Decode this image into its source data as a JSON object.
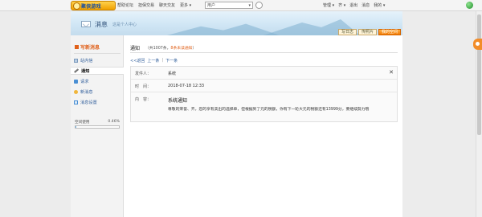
{
  "topbar": {
    "logo_text": "聚侠游戏",
    "nav": [
      "帮助论坛",
      "担保交易",
      "聊天交友",
      "更多 ▾"
    ],
    "user_select": "用户",
    "right_links": [
      "管理 ▾",
      "齐 ▾",
      "退出",
      "消息",
      "我的 ▾"
    ]
  },
  "banner": {
    "title": "消息",
    "subtitle": "这是个人中心",
    "buttons": [
      "写日志",
      "传照片",
      "我的空间"
    ]
  },
  "sidebar": {
    "compose": "写新消息",
    "items": [
      {
        "label": "站内信",
        "active": false,
        "icon": "inbox-icon"
      },
      {
        "label": "通知",
        "active": true,
        "icon": "pencil-icon"
      },
      {
        "label": "请求",
        "active": false,
        "icon": "request-icon"
      },
      {
        "label": "新消息",
        "active": false,
        "icon": "news-icon"
      },
      {
        "label": "消息设置",
        "active": false,
        "icon": "settings-icon"
      }
    ],
    "space_label": "空间使用",
    "space_pct": "0.46%",
    "space_value": 0.0046
  },
  "main": {
    "title": "通知",
    "count_prefix": "（共1007条，",
    "unread": "8条未读通知",
    "count_suffix": "）",
    "pager": {
      "back": "<<返回",
      "prev": "上一条",
      "sep": "|",
      "next": "下一条"
    },
    "message": {
      "sender_label": "发件人：",
      "sender": "系统",
      "time_label": "时　间：",
      "time": "2018-07-18 12:33",
      "content_label": "内　容：",
      "content_title": "系统通知",
      "content_body": "尊敬的荣誉、齐，您的享有卖出的选择单，但根据到了元的税额，你有下一轮大元的税额还有13999分，要继续努力哦"
    }
  },
  "colors": {
    "accent": "#e0611b",
    "link": "#2f5d9a",
    "banner_bg": "#d0e6f5",
    "orange_btn": "#f27a00"
  }
}
